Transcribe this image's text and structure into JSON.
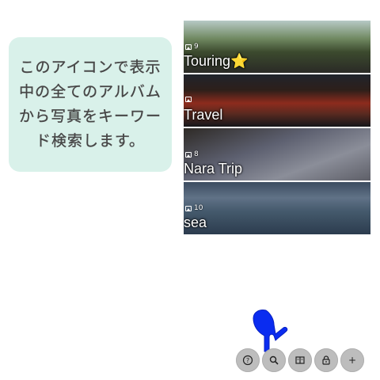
{
  "tooltip": {
    "text": "このアイコンで表示中の全てのアルバムから写真をキーワード検索します。"
  },
  "albums": [
    {
      "title": "Touring⭐️",
      "count": "9"
    },
    {
      "title": "Travel",
      "count": ""
    },
    {
      "title": "Nara Trip",
      "count": "8"
    },
    {
      "title": "sea",
      "count": "10"
    }
  ],
  "toolbar": {
    "help_icon": "?",
    "search_icon": "magnifier",
    "album_icon": "book",
    "lock_icon": "lock",
    "add_label": "+"
  },
  "colors": {
    "tooltip_bg": "#d9f1ea",
    "pointer": "#0a2cf0",
    "button_bg": "#bdbdbd"
  }
}
